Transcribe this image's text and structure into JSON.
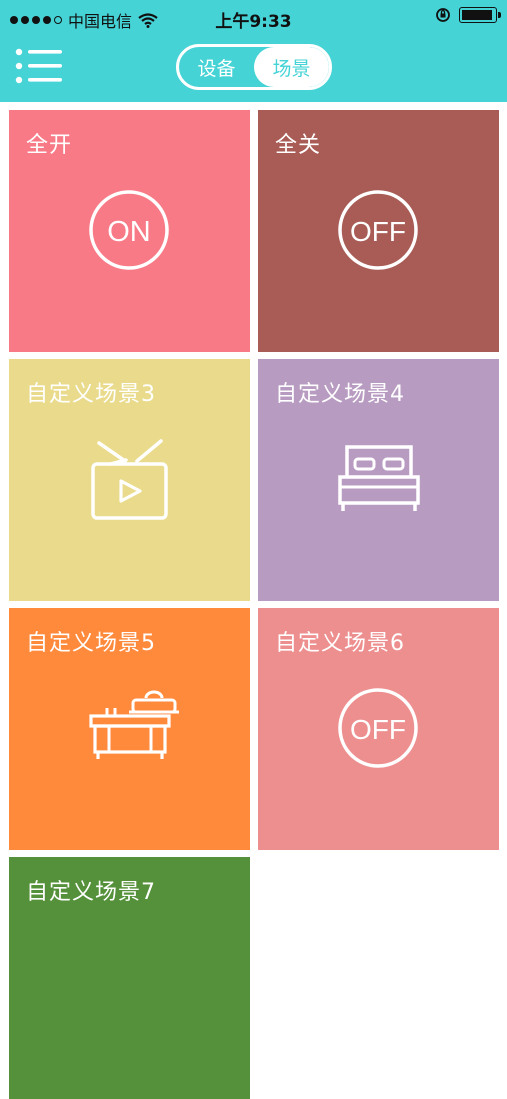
{
  "status_bar": {
    "carrier": "中国电信",
    "time": "上午9:33"
  },
  "header": {
    "menu_icon": "list-menu-icon",
    "segments": [
      {
        "label": "设备",
        "active": false
      },
      {
        "label": "场景",
        "active": true
      }
    ]
  },
  "scenes": [
    {
      "label": "全开",
      "color": "#f77a86",
      "icon": "on-power-icon",
      "icon_text": "ON"
    },
    {
      "label": "全关",
      "color": "#a95c55",
      "icon": "off-power-icon",
      "icon_text": "OFF"
    },
    {
      "label": "自定义场景3",
      "color": "#e9db8b",
      "icon": "tv-icon"
    },
    {
      "label": "自定义场景4",
      "color": "#b89bc1",
      "icon": "bed-icon"
    },
    {
      "label": "自定义场景5",
      "color": "#ff8a3c",
      "icon": "cooking-stove-icon"
    },
    {
      "label": "自定义场景6",
      "color": "#ee8f8f",
      "icon": "off-power-icon",
      "icon_text": "OFF"
    },
    {
      "label": "自定义场景7",
      "color": "#54913a",
      "icon": "scene-icon"
    }
  ],
  "colors": {
    "header_bg": "#45d3d6",
    "segment_active_text": "#45d3d6"
  }
}
